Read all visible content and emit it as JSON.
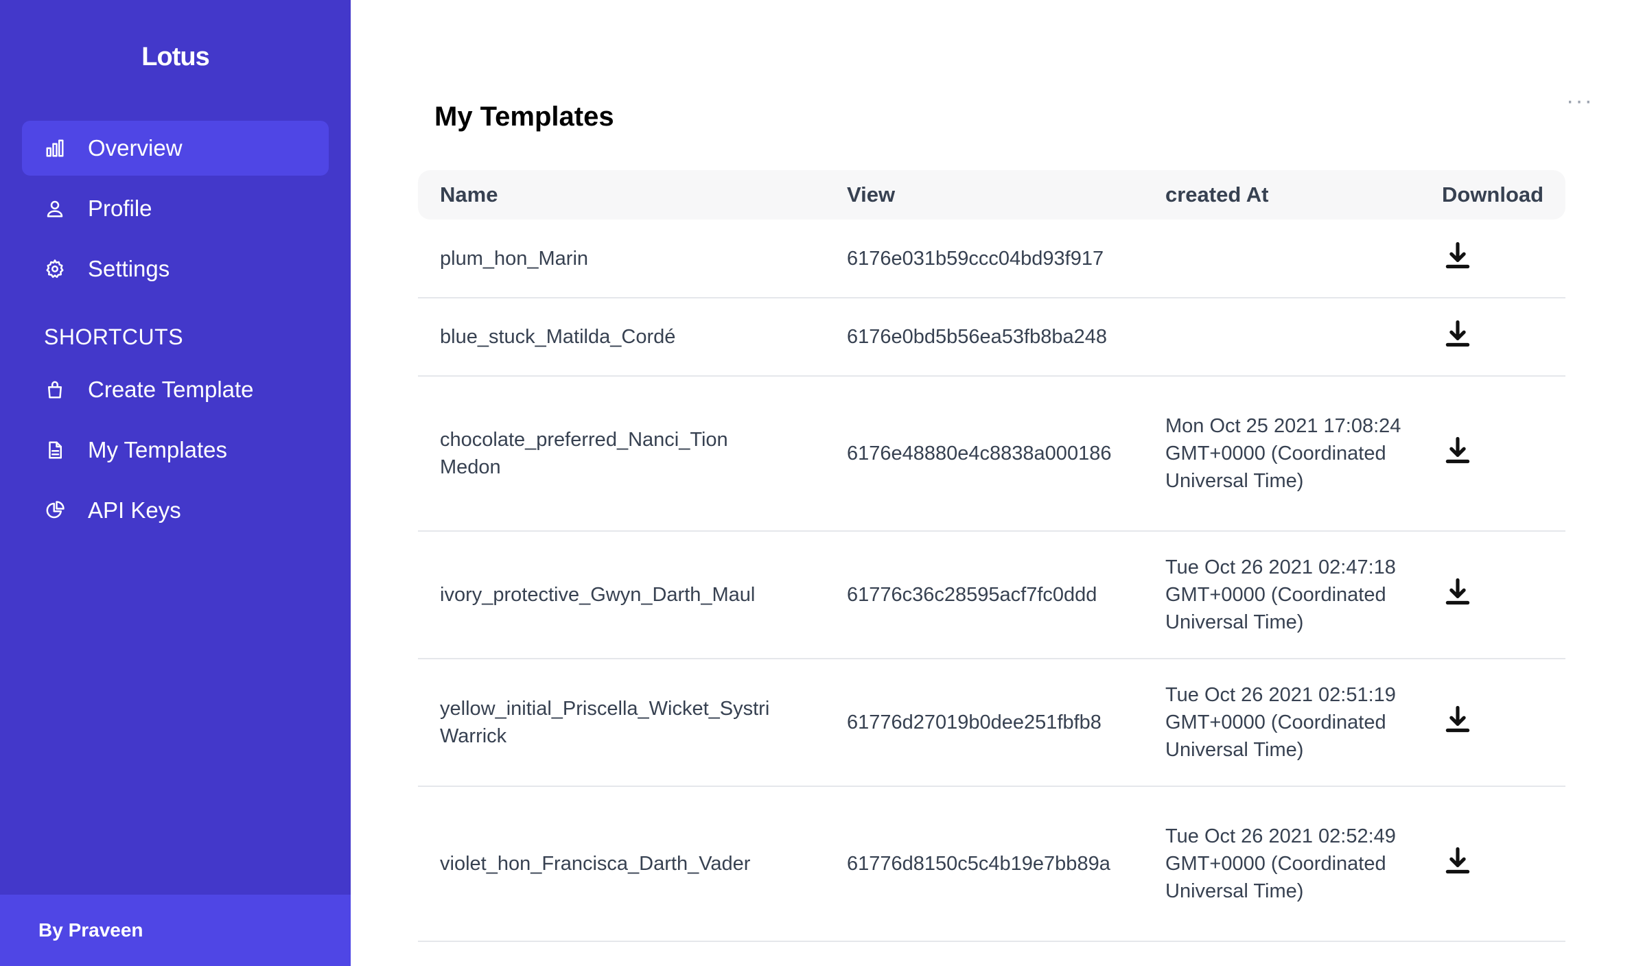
{
  "sidebar": {
    "brand": "Lotus",
    "nav": [
      {
        "label": "Overview",
        "icon": "bar-chart-icon",
        "active": true
      },
      {
        "label": "Profile",
        "icon": "user-icon",
        "active": false
      },
      {
        "label": "Settings",
        "icon": "gear-icon",
        "active": false
      }
    ],
    "shortcuts_title": "SHORTCUTS",
    "shortcuts": [
      {
        "label": "Create Template",
        "icon": "shopping-bag-icon"
      },
      {
        "label": "My Templates",
        "icon": "document-icon"
      },
      {
        "label": "API Keys",
        "icon": "pie-chart-icon"
      }
    ],
    "footer": "By Praveen"
  },
  "main": {
    "title": "My Templates",
    "more_label": "···",
    "table": {
      "headers": {
        "name": "Name",
        "view": "View",
        "created": "created At",
        "download": "Download"
      },
      "rows": [
        {
          "name": "plum_hon_Marin",
          "view": "6176e031b59ccc04bd93f917",
          "created": ""
        },
        {
          "name": "blue_stuck_Matilda_Cordé",
          "view": "6176e0bd5b56ea53fb8ba248",
          "created": ""
        },
        {
          "name": "chocolate_preferred_Nanci_Tion Medon",
          "view": "6176e48880e4c8838a000186",
          "created": "Mon Oct 25 2021 17:08:24 GMT+0000 (Coordinated Universal Time)"
        },
        {
          "name": "ivory_protective_Gwyn_Darth_Maul",
          "view": "61776c36c28595acf7fc0ddd",
          "created": "Tue Oct 26 2021 02:47:18 GMT+0000 (Coordinated Universal Time)"
        },
        {
          "name": "yellow_initial_Priscella_Wicket_Systri Warrick",
          "view": "61776d27019b0dee251fbfb8",
          "created": "Tue Oct 26 2021 02:51:19 GMT+0000 (Coordinated Universal Time)"
        },
        {
          "name": "violet_hon_Francisca_Darth_Vader",
          "view": "61776d8150c5c4b19e7bb89a",
          "created": "Tue Oct 26 2021 02:52:49 GMT+0000 (Coordinated Universal Time)"
        }
      ]
    }
  },
  "colors": {
    "sidebar_bg": "#4338ca",
    "active_bg": "#4f46e5",
    "footer_bg": "#4f46e5"
  }
}
